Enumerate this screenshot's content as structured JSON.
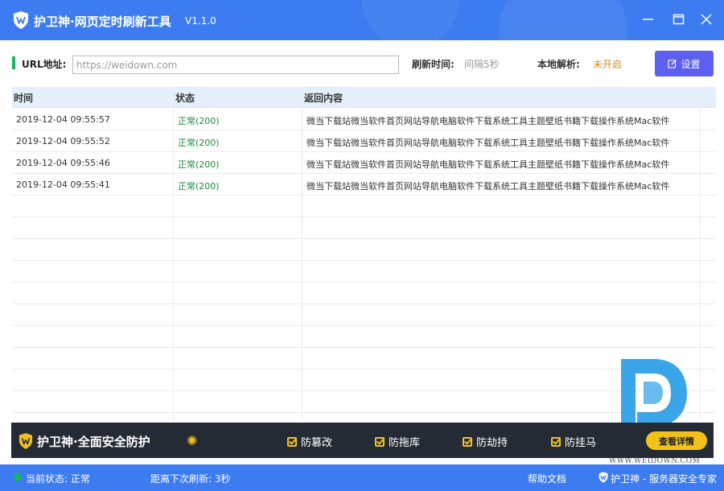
{
  "window": {
    "title": "护卫神·网页定时刷新工具",
    "version": "V1.1.0"
  },
  "toolbar": {
    "url_label": "URL地址:",
    "url_placeholder": "https://weidown.com",
    "url_value": "",
    "refresh_label": "刷新时间:",
    "refresh_value": "间隔5秒",
    "dns_label": "本地解析:",
    "dns_value": "未开启",
    "settings_label": "设置"
  },
  "table": {
    "columns": [
      "时间",
      "状态",
      "返回内容"
    ],
    "rows": [
      {
        "time": "2019-12-04 09:55:57",
        "status": "正常(200)",
        "content": "微当下载站微当软件首页网站导航电脑软件下载系统工具主题壁纸书籍下载操作系统Mac软件"
      },
      {
        "time": "2019-12-04 09:55:52",
        "status": "正常(200)",
        "content": "微当下载站微当软件首页网站导航电脑软件下载系统工具主题壁纸书籍下载操作系统Mac软件"
      },
      {
        "time": "2019-12-04 09:55:46",
        "status": "正常(200)",
        "content": "微当下载站微当软件首页网站导航电脑软件下载系统工具主题壁纸书籍下载操作系统Mac软件"
      },
      {
        "time": "2019-12-04 09:55:41",
        "status": "正常(200)",
        "content": "微当下载站微当软件首页网站导航电脑软件下载系统工具主题壁纸书籍下载操作系统Mac软件"
      }
    ]
  },
  "banner": {
    "slogan": "护卫神·全面安全防护",
    "features": [
      "防篡改",
      "防拖库",
      "防劫持",
      "防挂马"
    ],
    "detail_button": "查看详情"
  },
  "watermark": {
    "text": "WWW.WEIDOWN.COM"
  },
  "statusbar": {
    "state": "当前状态: 正常",
    "next_refresh": "距离下次刷新: 3秒",
    "help": "帮助文档",
    "brand": "护卫神 - 服务器安全专家"
  },
  "colors": {
    "primary": "#3d7cf0",
    "accent_green": "#16b463",
    "settings_button": "#5c5ff0",
    "status_ok": "#1a8a3c",
    "warning_orange": "#e08a1c",
    "banner_bg": "#252b35",
    "banner_yellow": "#f3c21a"
  },
  "icons": {
    "logo": "shield-w-icon",
    "minimize": "minimize-icon",
    "maximize": "maximize-icon",
    "close": "close-icon",
    "settings": "edit-icon",
    "watermark": "weidown-d-logo"
  }
}
